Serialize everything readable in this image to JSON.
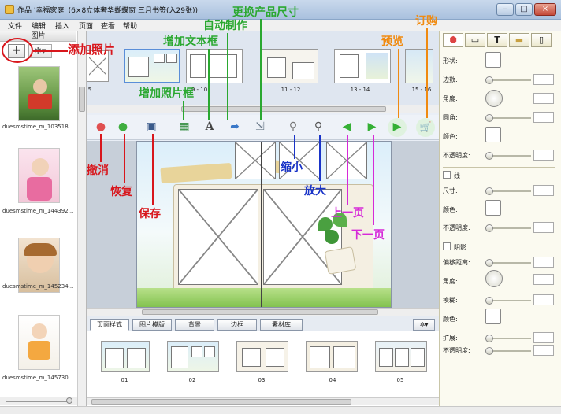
{
  "window": {
    "title": "作品 '幸福家庭' (6×8立体奢华蝴蝶窗 三月书签(入29张))",
    "buttons": {
      "minimize": "–",
      "maximize": "□",
      "close": "×"
    }
  },
  "menu": [
    "文件",
    "编辑",
    "插入",
    "页面",
    "查看",
    "帮助"
  ],
  "left_panel": {
    "header": "图片",
    "add_symbol": "+",
    "gear_symbol": "✲▾",
    "photos": [
      {
        "name": "duesmstime_m_103518..."
      },
      {
        "name": "duesmstime_m_144392..."
      },
      {
        "name": "duesmstime_m_145234..."
      },
      {
        "name": "duesmstime_m_145730..."
      }
    ]
  },
  "page_strip": {
    "pages": [
      {
        "label": "5"
      },
      {
        "label": "9 - 10"
      },
      {
        "label": "11 - 12"
      },
      {
        "label": "13 - 14"
      },
      {
        "label": "15 - 16"
      }
    ]
  },
  "toolbar": {
    "buttons": [
      {
        "name": "undo-button",
        "glyph": "●",
        "color": "#e05050"
      },
      {
        "name": "redo-button",
        "glyph": "●",
        "color": "#3fae3f"
      },
      {
        "name": "save-button",
        "glyph": "▣",
        "color": "#3a5a8a"
      },
      {
        "name": "add-photo-frame-button",
        "glyph": "▦",
        "color": "#2e8a3a"
      },
      {
        "name": "add-text-frame-button",
        "glyph": "A",
        "color": "#444444"
      },
      {
        "name": "auto-create-button",
        "glyph": "➦",
        "color": "#3a78c8"
      },
      {
        "name": "change-size-button",
        "glyph": "⇲",
        "color": "#6a7a8a"
      },
      {
        "name": "zoom-out-button",
        "glyph": "⚲",
        "color": "#777777"
      },
      {
        "name": "zoom-in-button",
        "glyph": "⚲",
        "color": "#555555"
      },
      {
        "name": "prev-page-button",
        "glyph": "◀",
        "color": "#35b035"
      },
      {
        "name": "next-page-button",
        "glyph": "▶",
        "color": "#35b035"
      },
      {
        "name": "preview-button",
        "glyph": "▶",
        "color": "#35b035"
      },
      {
        "name": "order-button",
        "glyph": "🛒",
        "color": "#2e9a2e"
      }
    ]
  },
  "tabs": [
    "页面样式",
    "图片模版",
    "背景",
    "边框",
    "素材库"
  ],
  "layouts": [
    {
      "label": "01"
    },
    {
      "label": "02"
    },
    {
      "label": "03"
    },
    {
      "label": "04"
    },
    {
      "label": "05"
    }
  ],
  "right_panel": {
    "tabs": [
      "⬢",
      "▭",
      "T",
      "▬",
      "▯"
    ],
    "shape_section": [
      {
        "label": "形状:",
        "control": "swatch"
      },
      {
        "label": "边数:",
        "control": "slider"
      },
      {
        "label": "角度:",
        "control": "dial"
      },
      {
        "label": "圆角:",
        "control": "slider"
      },
      {
        "label": "颜色:",
        "control": "swatch"
      },
      {
        "label": "不透明度:",
        "control": "slider"
      }
    ],
    "line_section": {
      "title": "线",
      "rows": [
        {
          "label": "尺寸:",
          "control": "slider"
        },
        {
          "label": "颜色:",
          "control": "swatch"
        },
        {
          "label": "不透明度:",
          "control": "slider"
        }
      ]
    },
    "shadow_section": {
      "title": "阴影",
      "rows": [
        {
          "label": "偏移距离:",
          "control": "slider"
        },
        {
          "label": "角度:",
          "control": "dial"
        },
        {
          "label": "模糊:",
          "control": "slider"
        },
        {
          "label": "颜色:",
          "control": "swatch"
        },
        {
          "label": "扩展:",
          "control": "slider"
        },
        {
          "label": "不透明度:",
          "control": "slider"
        }
      ]
    }
  },
  "annotations": {
    "add_photo": "添加照片",
    "add_text_frame": "增加文本框",
    "auto_create": "自动制作",
    "change_size": "更换产品尺寸",
    "preview": "预览",
    "order": "订购",
    "add_photo_frame": "增加照片框",
    "undo": "撤消",
    "redo": "恢复",
    "save": "保存",
    "zoom_out": "缩小",
    "zoom_in": "放大",
    "prev_page": "上一页",
    "next_page": "下一页"
  },
  "colors": {
    "annotation_red": "#d8161c",
    "annotation_green": "#2aa830",
    "annotation_orange": "#f08a10",
    "annotation_blue": "#1a34c8",
    "annotation_magenta": "#d62ad8"
  }
}
